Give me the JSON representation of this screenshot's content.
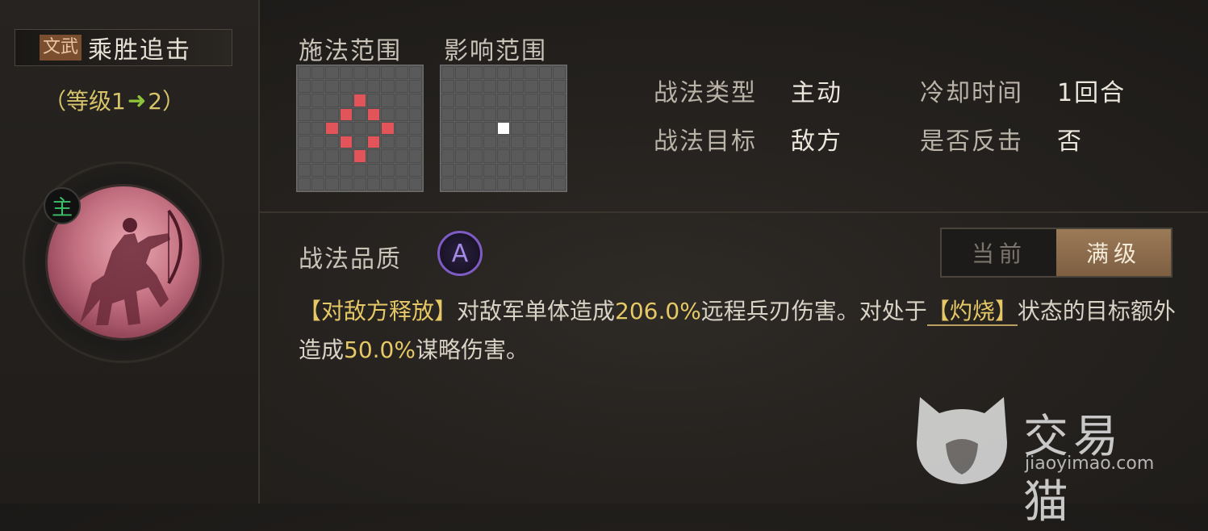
{
  "skill": {
    "type_tag": "文武",
    "name": "乘胜追击",
    "level_prefix": "（等级1",
    "level_arrow": "➜",
    "level_suffix": "2）",
    "commander_badge": "主"
  },
  "ranges": {
    "cast_label": "施法范围",
    "effect_label": "影响范围"
  },
  "info": {
    "tactic_type_label": "战法类型",
    "tactic_type_value": "主动",
    "cooldown_label": "冷却时间",
    "cooldown_value": "1回合",
    "target_label": "战法目标",
    "target_value": "敌方",
    "counter_label": "是否反击",
    "counter_value": "否"
  },
  "quality": {
    "label": "战法品质",
    "grade": "A"
  },
  "toggle": {
    "current": "当前",
    "max": "满级",
    "selected": "满级"
  },
  "description": {
    "p1": "【对敌方释放】",
    "p2": "对敌军单体造成",
    "p3": "206.0%",
    "p4": "远程兵刃伤害。对处于",
    "p5": "【灼烧】",
    "p6": "状态的目标额外造成",
    "p7": "50.0%",
    "p8": "谋略伤害。"
  },
  "watermark": {
    "title": "交易猫",
    "url": "jiaoyimao.com"
  },
  "colors": {
    "highlight": "#e6c866",
    "range_cell": "#e0545a",
    "effect_cell": "#ffffff",
    "commander": "#3ec06a",
    "quality_ring": "#7e5cc4"
  }
}
